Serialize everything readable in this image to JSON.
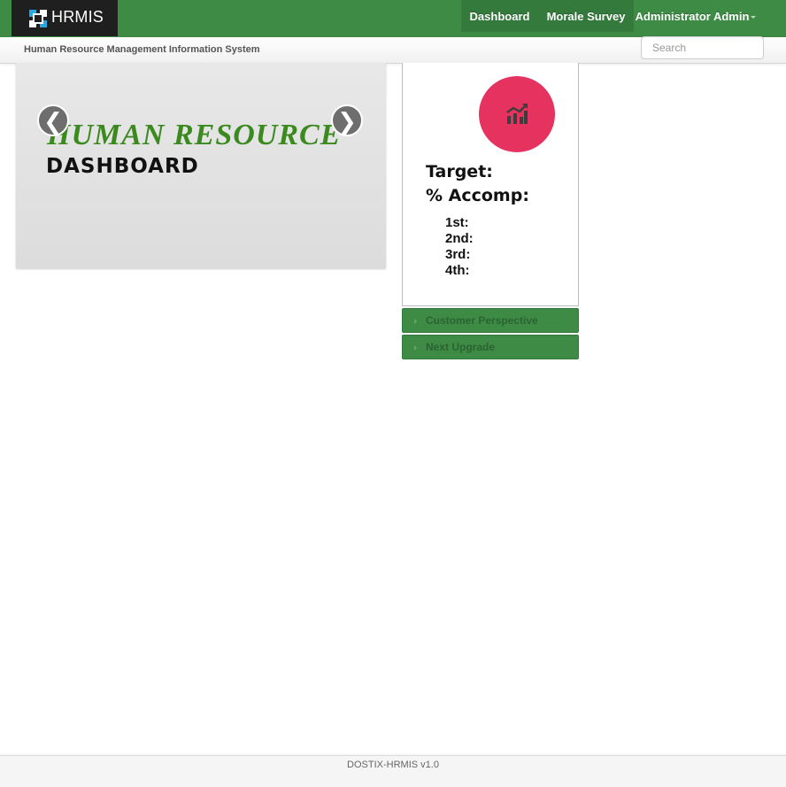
{
  "navbar": {
    "brand": "HRMIS",
    "items": [
      {
        "label": "Dashboard"
      },
      {
        "label": "Morale Survey"
      },
      {
        "label": "Administrator Admin"
      }
    ]
  },
  "subheader": {
    "title": "Human Resource Management Information System",
    "search_placeholder": "Search",
    "search_value": ""
  },
  "carousel": {
    "title": "HUMAN RESOURCE",
    "subtitle": "DASHBOARD",
    "prev_glyph": "❮",
    "next_glyph": "❯"
  },
  "stats_card": {
    "icon": "chart-line-icon",
    "circle_color": "#e5325f",
    "target_label": "Target:",
    "accomp_label": "% Accomp:",
    "quarters": [
      "1st:",
      "2nd:",
      "3rd:",
      "4th:"
    ]
  },
  "accordion": [
    {
      "label": "Customer Perspective"
    },
    {
      "label": "Next Upgrade"
    }
  ],
  "footer": {
    "text": "DOSTIX-HRMIS v1.0"
  },
  "colors": {
    "navbar": "#3d8b45",
    "navbar_active": "#347a3c",
    "brand_bg": "#1f1f1f",
    "accent_title": "#3a8a1f"
  }
}
